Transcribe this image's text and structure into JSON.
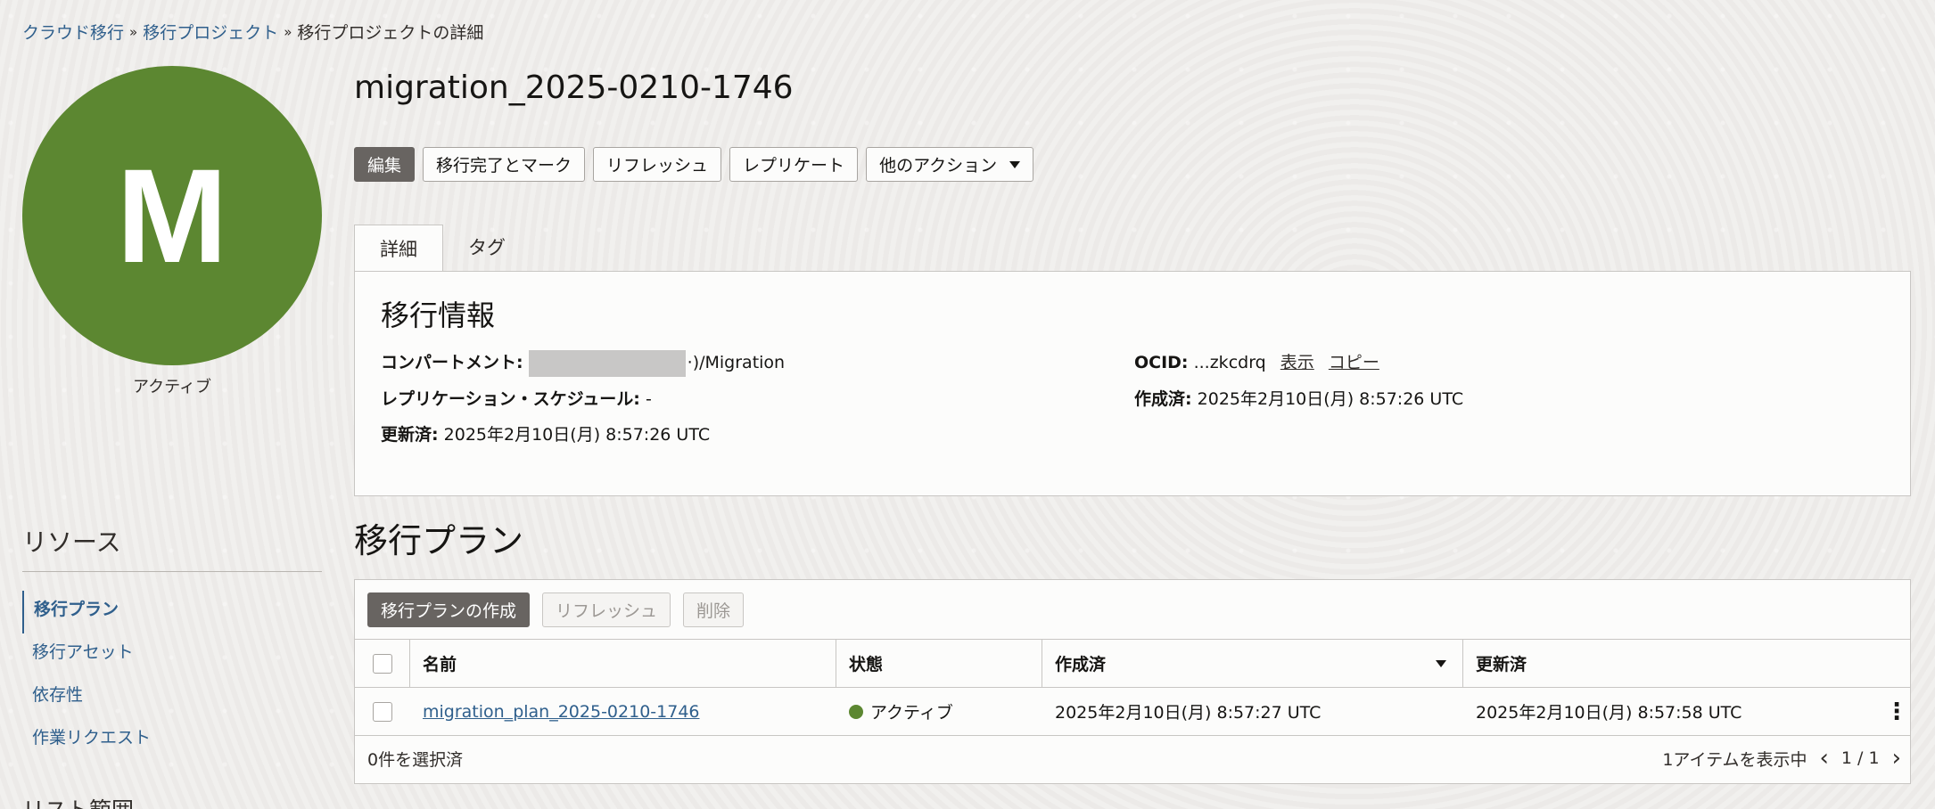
{
  "breadcrumb": {
    "items": [
      "クラウド移行",
      "移行プロジェクト",
      "移行プロジェクトの詳細"
    ],
    "separator": "»"
  },
  "avatar": {
    "letter": "M",
    "status": "アクティブ",
    "color": "#5c8731"
  },
  "title": "migration_2025-0210-1746",
  "actions": {
    "edit": "編集",
    "mark_complete": "移行完了とマーク",
    "refresh": "リフレッシュ",
    "replicate": "レプリケート",
    "more": "他のアクション"
  },
  "tabs": {
    "details": "詳細",
    "tags": "タグ"
  },
  "info": {
    "title": "移行情報",
    "compartment_label": "コンパートメント:",
    "compartment_value": "·)/Migration",
    "schedule_label": "レプリケーション・スケジュール:",
    "schedule_value": "-",
    "updated_label": "更新済:",
    "updated_value": "2025年2月10日(月) 8:57:26 UTC",
    "ocid_label": "OCID:",
    "ocid_value": "...zkcdrq",
    "ocid_show": "表示",
    "ocid_copy": "コピー",
    "created_label": "作成済:",
    "created_value": "2025年2月10日(月) 8:57:26 UTC"
  },
  "resources": {
    "title": "リソース",
    "items": [
      "移行プラン",
      "移行アセット",
      "依存性",
      "作業リクエスト"
    ],
    "active_index": 0,
    "next_heading": "リスト範囲"
  },
  "plans": {
    "title": "移行プラン",
    "create_button": "移行プランの作成",
    "refresh_button": "リフレッシュ",
    "delete_button": "削除",
    "columns": {
      "name": "名前",
      "state": "状態",
      "created": "作成済",
      "updated": "更新済"
    },
    "rows": [
      {
        "name": "migration_plan_2025-0210-1746",
        "state": "アクティブ",
        "created": "2025年2月10日(月) 8:57:27 UTC",
        "updated": "2025年2月10日(月) 8:57:58 UTC"
      }
    ],
    "selected_text": "0件を選択済",
    "showing_text": "1アイテムを表示中",
    "page_text": "1 / 1"
  },
  "icons": {
    "more_caret": "caret-down-icon",
    "sort": "sort-desc-icon",
    "row_actions": "kebab-icon",
    "prev": "chevron-left-icon",
    "next": "chevron-right-icon"
  }
}
